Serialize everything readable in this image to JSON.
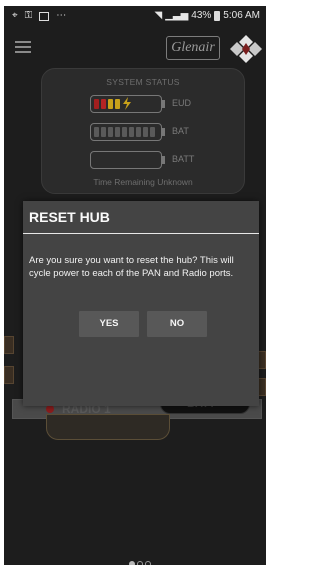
{
  "status_bar": {
    "battery_percent": "43%",
    "time": "5:06 AM",
    "icons": [
      "location-icon",
      "key-icon",
      "image-icon",
      "more-icon",
      "wifi-icon",
      "signal-icon",
      "battery-icon"
    ]
  },
  "header": {
    "logo_text": "Glenair"
  },
  "system_status": {
    "title": "SYSTEM STATUS",
    "rows": [
      {
        "label": "EUD",
        "fill": 0.3
      },
      {
        "label": "BAT",
        "fill": 1.0
      },
      {
        "label": "BATT",
        "fill": 0.0
      }
    ],
    "time_remaining": "Time Remaining Unknown"
  },
  "background": {
    "radio_label": "RADIO 1",
    "batt_label": "BATT"
  },
  "dialog": {
    "title": "RESET HUB",
    "message": "Are you sure you want to reset the hub? This will cycle power to each of the PAN and Radio ports.",
    "yes_label": "YES",
    "no_label": "NO"
  },
  "pager": {
    "count": 3,
    "active": 0
  },
  "colors": {
    "screen_bg": "#1d1d1d",
    "dialog_bg": "#444444",
    "button_bg": "#585858",
    "eud_red": "#a31f1f",
    "eud_yellow": "#c9a21a"
  }
}
